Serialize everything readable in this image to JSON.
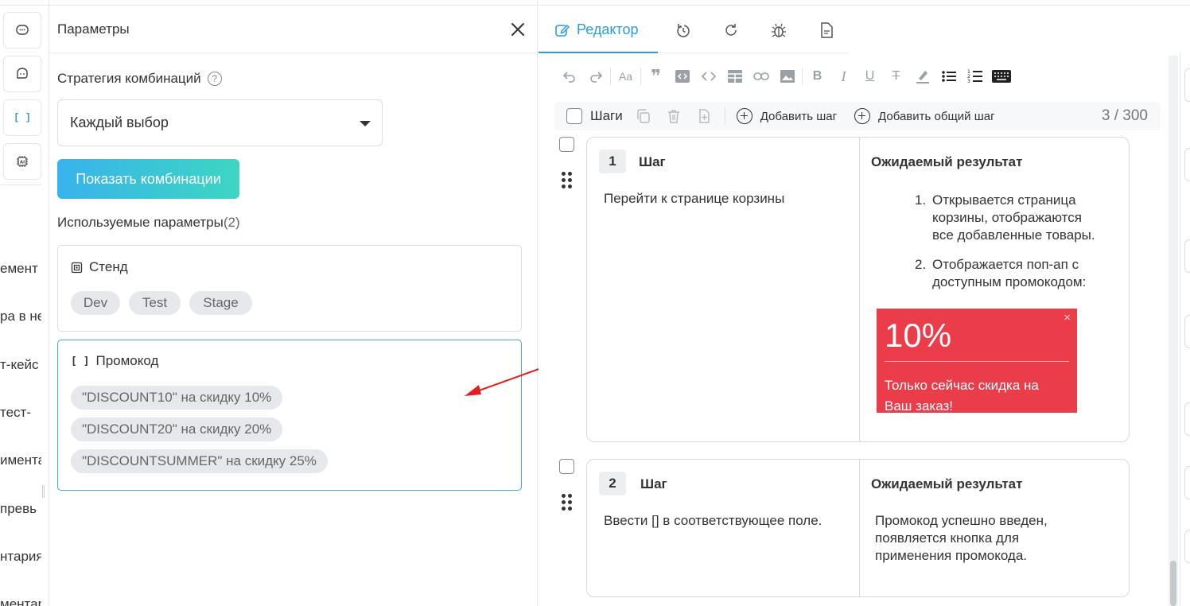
{
  "background": {
    "texts": [
      "емент",
      "ра в не",
      "т-кейс",
      " тест-",
      "имента",
      "превь",
      "нтария",
      "ментар"
    ]
  },
  "params": {
    "title": "Параметры",
    "strategy_label": "Стратегия комбинаций",
    "strategy_value": "Каждый выбор",
    "show_button": "Показать комбинации",
    "used_label": "Используемые параметры",
    "used_count": "(2)",
    "cards": [
      {
        "title": "Стенд",
        "icon": "server-icon",
        "tags": [
          "Dev",
          "Test",
          "Stage"
        ]
      },
      {
        "title": "Промокод",
        "icon": "brackets-icon",
        "tags": [
          "\"DISCOUNT10\" на скидку 10%",
          "\"DISCOUNT20\" на скидку 20%",
          "\"DISCOUNTSUMMER\" на скидку 25%"
        ]
      }
    ]
  },
  "editor": {
    "tab_label": "Редактор",
    "steps_label": "Шаги",
    "add_step": "Добавить шаг",
    "add_shared_step": "Добавить общий шаг",
    "counter": "3 / 300",
    "steps": [
      {
        "num": "1",
        "step_label": "Шаг",
        "result_label": "Ожидаемый результат",
        "action": "Перейти к странице корзины",
        "results": [
          {
            "n": "1.",
            "text": "Открывается страница корзины, отображаются все добавленные товары."
          },
          {
            "n": "2.",
            "text": "Отображается поп-ап с доступным промокодом:"
          }
        ],
        "promo": {
          "percent": "10%",
          "text": "Только сейчас скидка на Ваш заказ!",
          "close": "×"
        }
      },
      {
        "num": "2",
        "step_label": "Шаг",
        "result_label": "Ожидаемый результат",
        "action": "Ввести [] в соответствующее поле.",
        "result_text": "Промокод успешно введен, появляется кнопка для применения промокода."
      }
    ]
  },
  "colors": {
    "accent": "#2d9cdb",
    "promo_bg": "#ea3c49",
    "arrow": "#e02020"
  }
}
